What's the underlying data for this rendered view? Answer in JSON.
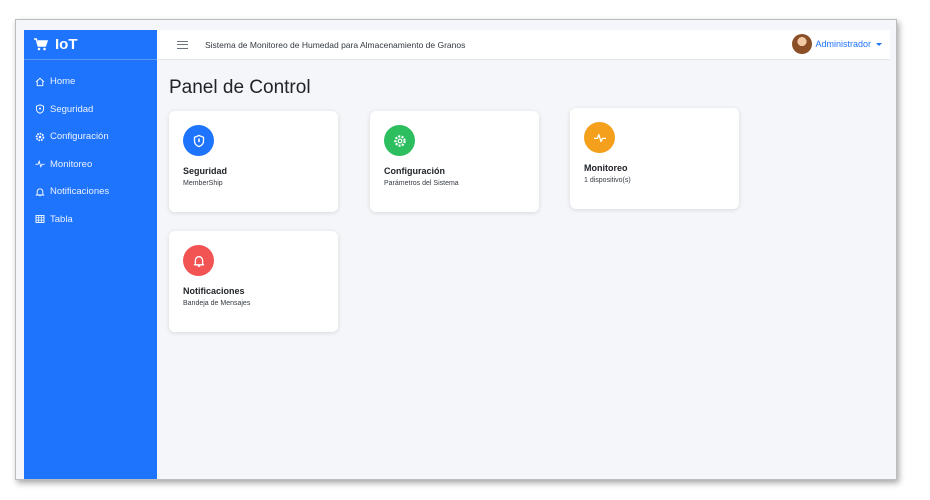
{
  "sidebar": {
    "brand": "IoT",
    "items": [
      {
        "label": "Home",
        "icon": "home-icon"
      },
      {
        "label": "Seguridad",
        "icon": "shield-icon"
      },
      {
        "label": "Configuración",
        "icon": "gear-icon"
      },
      {
        "label": "Monitoreo",
        "icon": "activity-icon"
      },
      {
        "label": "Notificaciones",
        "icon": "bell-icon"
      },
      {
        "label": "Tabla",
        "icon": "table-icon"
      }
    ]
  },
  "header": {
    "title": "Sistema de Monitoreo de Humedad para Almacenamiento de Granos",
    "user": "Administrador"
  },
  "main": {
    "title": "Panel de Control",
    "cards": [
      {
        "title": "Seguridad",
        "subtitle": "MemberShip",
        "icon": "shield-icon",
        "color": "#1f74fd"
      },
      {
        "title": "Configuración",
        "subtitle": "Parámetros del Sistema",
        "icon": "gear-icon",
        "color": "#2dbe60"
      },
      {
        "title": "Monitoreo",
        "subtitle": "1 dispositivo(s)",
        "icon": "activity-icon",
        "color": "#f4a01d"
      },
      {
        "title": "Notificaciones",
        "subtitle": "Bandeja de Mensajes",
        "icon": "bell-icon",
        "color": "#f25353"
      }
    ]
  }
}
